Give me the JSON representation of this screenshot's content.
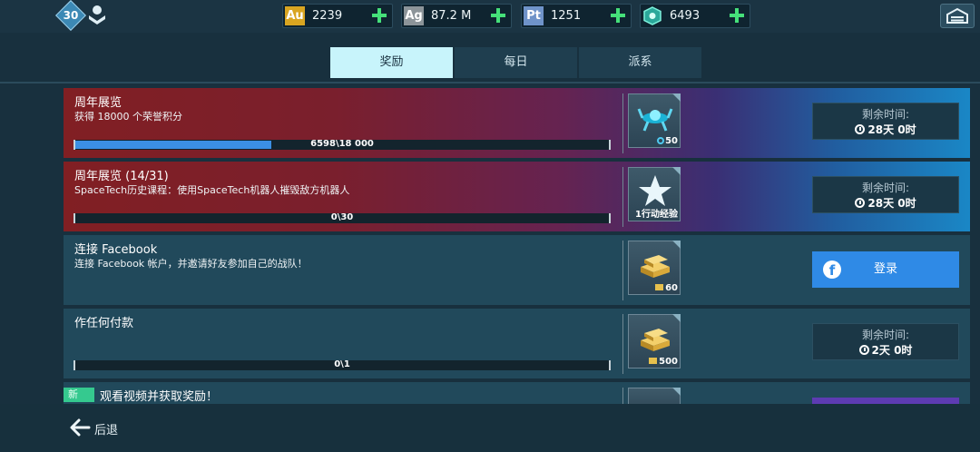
{
  "topbar": {
    "level": "30",
    "resources": [
      {
        "icon_text": "Au",
        "icon_color": "#d9a521",
        "value": "2239"
      },
      {
        "icon_text": "Ag",
        "icon_color": "#8c9499",
        "value": "87.2 M"
      },
      {
        "icon_text": "Pt",
        "icon_color": "#6f93c9",
        "value": "1251"
      },
      {
        "icon_text": "",
        "icon_color": "#2ba89a",
        "value": "6493"
      }
    ]
  },
  "tabs": [
    {
      "label": "奖励",
      "active": true
    },
    {
      "label": "每日",
      "active": false
    },
    {
      "label": "派系",
      "active": false
    }
  ],
  "rows": [
    {
      "title": "周年展览",
      "desc": "获得 18000 个荣誉积分",
      "progress_text": "6598\\18 000",
      "progress_fraction": 0.367,
      "reward_value": "50",
      "reward_icon": "drone-icon",
      "timer_label": "剩余时间:",
      "timer_value": "28天 0时"
    },
    {
      "title": "周年展览 (14/31)",
      "desc": "SpaceTech历史课程：使用SpaceTech机器人摧毁敌方机器人",
      "progress_text": "0\\30",
      "progress_fraction": 0,
      "reward_value": "1行动经验",
      "reward_icon": "star-icon",
      "timer_label": "剩余时间:",
      "timer_value": "28天 0时"
    },
    {
      "title": "连接 Facebook",
      "desc": "连接 Facebook 帐户，并邀请好友参加自己的战队！",
      "reward_value": "60",
      "reward_icon": "gold-bars-icon",
      "button_label": "登录"
    },
    {
      "title": "作任何付款",
      "progress_text": "0\\1",
      "progress_fraction": 0,
      "reward_value": "500",
      "reward_icon": "gold-bars-icon",
      "timer_label": "剩余时间:",
      "timer_value": "2天 0时"
    },
    {
      "badge": "新",
      "title": "观看视频并获取奖励！"
    }
  ],
  "footer": {
    "back_label": "后退"
  },
  "colors": {
    "accent_tab": "#c8f4fb",
    "progress": "#3b8fe4",
    "login": "#2f8ae6",
    "plus": "#45e07a"
  }
}
